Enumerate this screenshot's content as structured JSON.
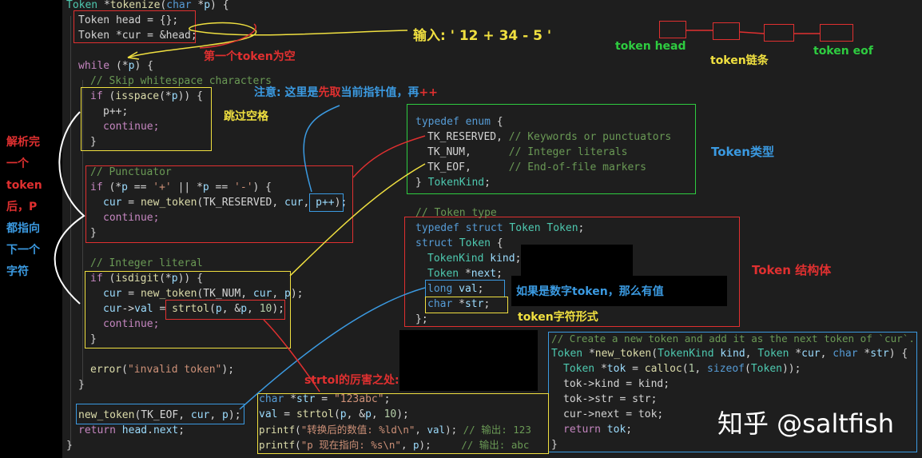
{
  "code_lines": {
    "l1": "Token *tokenize(char *p) {",
    "l2": "Token head = {};",
    "l3": "Token *cur = &head;",
    "l4": "while (*p) {",
    "l5": "// Skip whitespace characters",
    "l6": "if (isspace(*p)) {",
    "l7": "p++;",
    "l8": "continue;",
    "l9": "}",
    "l10": "// Punctuator",
    "l11": "if (*p == '+' || *p == '-') {",
    "l12": "cur = new_token(TK_RESERVED, cur, p++);",
    "l13": "continue;",
    "l14": "}",
    "l15": "// Integer literal",
    "l16": "if (isdigit(*p)) {",
    "l17": "cur = new_token(TK_NUM, cur, p);",
    "l18": "cur->val = strtol(p, &p, 10);",
    "l19": "continue;",
    "l20": "}",
    "l21": "error(\"invalid token\");",
    "l22": "}",
    "l23": "new_token(TK_EOF, cur, p);",
    "l24": "return head.next;",
    "l25": "}"
  },
  "enum_block": {
    "l1": "typedef enum {",
    "l2": "TK_RESERVED, // Keywords or punctuators",
    "l3": "TK_NUM,      // Integer literals",
    "l4": "TK_EOF,      // End-of-file markers",
    "l5": "} TokenKind;"
  },
  "struct_block": {
    "l1": "// Token type",
    "l2": "typedef struct Token Token;",
    "l3": "struct Token {",
    "l4": "TokenKind kind;",
    "l5": "Token *next;",
    "l6": "long val;",
    "l7": "char *str;",
    "l8": "};"
  },
  "new_token_block": {
    "l1": "// Create a new token and add it as the next token of `cur`.",
    "l2": "Token *new_token(TokenKind kind, Token *cur, char *str) {",
    "l3": "Token *tok = calloc(1, sizeof(Token));",
    "l4": "tok->kind = kind;",
    "l5": "tok->str = str;",
    "l6": "cur->next = tok;",
    "l7": "return tok;",
    "l8": "}"
  },
  "strtol_block": {
    "l1": "char *str = \"123abc\";",
    "l2": "val = strtol(p, &p, 10);",
    "l3": "printf(\"转换后的数值: %ld\\n\", val); // 输出: 123",
    "l4": "printf(\"p 现在指向: %s\\n\", p);     // 输出: abc"
  },
  "annotations": {
    "input": "输入: ' 12 + 34 - 5 '",
    "first_token_empty": "第一个token为空",
    "note_p": "注意: 这里是先取当前指针值，再++",
    "skip_space": "跳过空格",
    "left_note": [
      "解析完",
      "一个",
      "token",
      "后，P",
      "都指向",
      "下一个",
      "字符"
    ],
    "token_head": "token head",
    "token_chain": "token链条",
    "token_eof": "token eof",
    "token_type": "Token类型",
    "token_struct": "Token 结构体",
    "num_val": "如果是数字token，那么有值",
    "str_form": "token字符形式",
    "strtol_power": "strtol的厉害之处:",
    "watermark": "知乎 @saltfish"
  },
  "colors": {
    "red": "#e03030",
    "yellow": "#f0e040",
    "green": "#2ecc40",
    "blue": "#3b9ae1",
    "white": "#ffffff"
  }
}
